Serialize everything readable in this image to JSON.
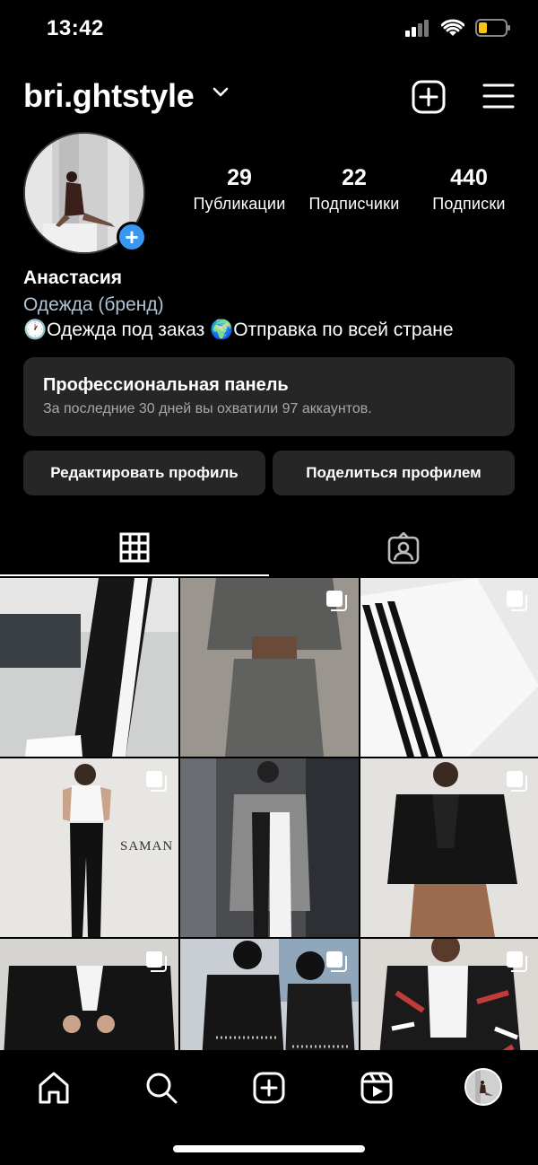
{
  "status_bar": {
    "time": "13:42"
  },
  "header": {
    "username": "bri.ghtstyle"
  },
  "profile": {
    "stats": [
      {
        "value": "29",
        "label": "Публикации"
      },
      {
        "value": "22",
        "label": "Подписчики"
      },
      {
        "value": "440",
        "label": "Подписки"
      }
    ],
    "name": "Анастасия",
    "category": "Одежда (бренд)",
    "bio": "🕐Одежда под заказ 🌍Отправка по всей стране"
  },
  "pro_panel": {
    "title": "Профессиональная панель",
    "subtitle": "За последние 30 дней вы охватили 97 аккаунтов."
  },
  "buttons": {
    "edit_profile": "Редактировать профиль",
    "share_profile": "Поделиться профилем"
  },
  "tabs": [
    {
      "icon": "grid-icon",
      "active": true
    },
    {
      "icon": "tagged-icon",
      "active": false
    }
  ],
  "posts": [
    {
      "description": "black pants with side stripe",
      "multi": false
    },
    {
      "description": "grey sweatsuit",
      "multi": true
    },
    {
      "description": "white pants with black stripes",
      "multi": true
    },
    {
      "description": "white top black leggings",
      "multi": true,
      "watermark": "SAMAN"
    },
    {
      "description": "grey coat black white pants",
      "multi": false
    },
    {
      "description": "black leather jacket leopard skirt",
      "multi": true
    },
    {
      "description": "black leather jacket",
      "multi": true
    },
    {
      "description": "fringe jacket and cap",
      "multi": true
    },
    {
      "description": "graffiti leather jacket",
      "multi": true
    }
  ],
  "bottom_nav": [
    "home-icon",
    "search-icon",
    "add-post-icon",
    "reels-icon",
    "profile-avatar"
  ],
  "colors": {
    "accent": "#3897f0",
    "panel": "#262626",
    "background": "#000000"
  }
}
